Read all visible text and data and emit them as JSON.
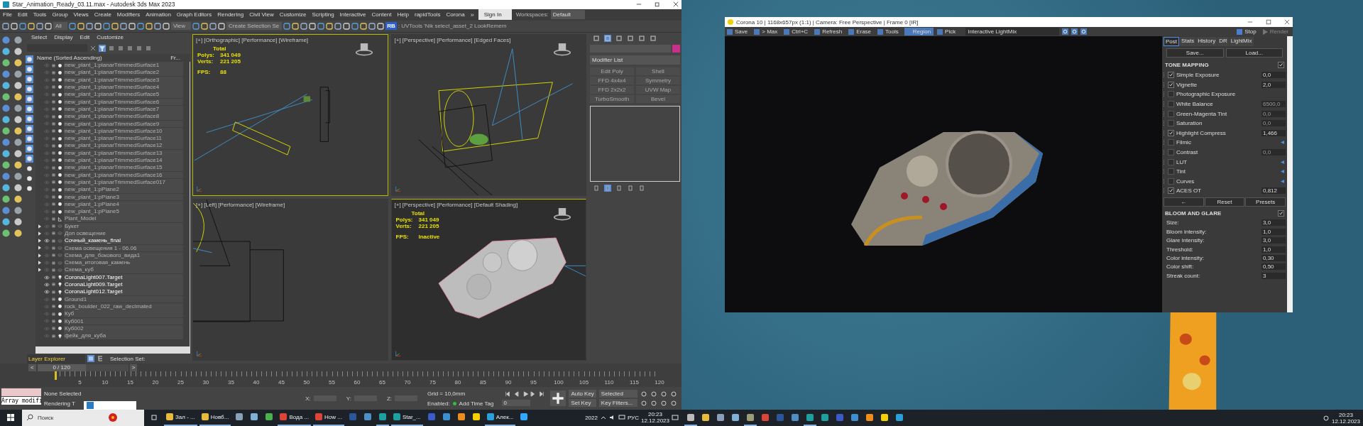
{
  "max": {
    "title": "Star_Animation_Ready_03.11.max - Autodesk 3ds Max 2023",
    "menu": [
      "File",
      "Edit",
      "Tools",
      "Group",
      "Views",
      "Create",
      "Modifiers",
      "Animation",
      "Graph Editors",
      "Rendering",
      "Civil View",
      "Customize",
      "Scripting",
      "Interactive",
      "Content",
      "Help",
      "rapidTools",
      "Corona"
    ],
    "more_menu": "»",
    "sign_in": "Sign In",
    "workspaces_label": "Workspaces:",
    "workspace": "Default",
    "toolbar": {
      "selection_filter": "All",
      "coord_system": "View",
      "selection_set": "Create Selection Se",
      "rb_badge": "RB",
      "script_text": ": UVTools 'Nik select_asset_2",
      "extra_text": "LookRemem"
    },
    "explorer": {
      "tabs": [
        "Select",
        "Display",
        "Edit",
        "Customize"
      ],
      "column_name": "Name (Sorted Ascending)",
      "column_2": "Fr...",
      "rows": [
        {
          "name": "new_plant_1:planarTrimmedSurface1",
          "kind": "object",
          "visible": false,
          "expandable": false
        },
        {
          "name": "new_plant_1:planarTrimmedSurface2",
          "kind": "object",
          "visible": false,
          "expandable": false
        },
        {
          "name": "new_plant_1:planarTrimmedSurface3",
          "kind": "object",
          "visible": false,
          "expandable": false
        },
        {
          "name": "new_plant_1:planarTrimmedSurface4",
          "kind": "object",
          "visible": false,
          "expandable": false
        },
        {
          "name": "new_plant_1:planarTrimmedSurface5",
          "kind": "object",
          "visible": false,
          "expandable": false
        },
        {
          "name": "new_plant_1:planarTrimmedSurface6",
          "kind": "object",
          "visible": false,
          "expandable": false
        },
        {
          "name": "new_plant_1:planarTrimmedSurface7",
          "kind": "object",
          "visible": false,
          "expandable": false
        },
        {
          "name": "new_plant_1:planarTrimmedSurface8",
          "kind": "object",
          "visible": false,
          "expandable": false
        },
        {
          "name": "new_plant_1:planarTrimmedSurface9",
          "kind": "object",
          "visible": false,
          "expandable": false
        },
        {
          "name": "new_plant_1:planarTrimmedSurface10",
          "kind": "object",
          "visible": false,
          "expandable": false
        },
        {
          "name": "new_plant_1:planarTrimmedSurface11",
          "kind": "object",
          "visible": false,
          "expandable": false
        },
        {
          "name": "new_plant_1:planarTrimmedSurface12",
          "kind": "object",
          "visible": false,
          "expandable": false
        },
        {
          "name": "new_plant_1:planarTrimmedSurface13",
          "kind": "object",
          "visible": false,
          "expandable": false
        },
        {
          "name": "new_plant_1:planarTrimmedSurface14",
          "kind": "object",
          "visible": false,
          "expandable": false
        },
        {
          "name": "new_plant_1:planarTrimmedSurface15",
          "kind": "object",
          "visible": false,
          "expandable": false
        },
        {
          "name": "new_plant_1:planarTrimmedSurface16",
          "kind": "object",
          "visible": false,
          "expandable": false
        },
        {
          "name": "new_plant_1:planarTrimmedSurface017",
          "kind": "object",
          "visible": false,
          "expandable": false
        },
        {
          "name": "new_plant_1:pPlane2",
          "kind": "object",
          "visible": false,
          "expandable": false
        },
        {
          "name": "new_plant_1:pPlane3",
          "kind": "object",
          "visible": false,
          "expandable": false
        },
        {
          "name": "new_plant_1:pPlane4",
          "kind": "object",
          "visible": false,
          "expandable": false
        },
        {
          "name": "new_plant_1:pPlane5",
          "kind": "object",
          "visible": false,
          "expandable": false
        },
        {
          "name": "Plant_Model",
          "kind": "bone",
          "visible": false,
          "expandable": false
        },
        {
          "name": "Букет",
          "kind": "layer",
          "visible": false,
          "expandable": true
        },
        {
          "name": "Доп освещение",
          "kind": "layer",
          "visible": false,
          "expandable": true
        },
        {
          "name": "Сочный_камень_final",
          "kind": "layer",
          "visible": true,
          "expandable": true
        },
        {
          "name": "Схема освещения 1 - 06.06",
          "kind": "layer",
          "visible": false,
          "expandable": true
        },
        {
          "name": "Схема_для_бокового_вида1",
          "kind": "layer",
          "visible": false,
          "expandable": true
        },
        {
          "name": "Схема_итоговая_камень",
          "kind": "layer",
          "visible": false,
          "expandable": true
        },
        {
          "name": "Схема_куб",
          "kind": "layer",
          "visible": false,
          "expandable": true
        },
        {
          "name": "CoronaLight007.Target",
          "kind": "light",
          "visible": true,
          "expandable": false
        },
        {
          "name": "CoronaLight009.Target",
          "kind": "light",
          "visible": true,
          "expandable": false
        },
        {
          "name": "CoronaLight012.Target",
          "kind": "light",
          "visible": true,
          "expandable": false
        },
        {
          "name": "Ground1",
          "kind": "object",
          "visible": false,
          "expandable": false
        },
        {
          "name": "rock_boulder_022_raw_decimated",
          "kind": "object",
          "visible": false,
          "expandable": false
        },
        {
          "name": "Куб",
          "kind": "object",
          "visible": false,
          "expandable": false
        },
        {
          "name": "Куб001",
          "kind": "object",
          "visible": false,
          "expandable": false
        },
        {
          "name": "Куб002",
          "kind": "object",
          "visible": false,
          "expandable": false
        },
        {
          "name": "фейк_для_куба",
          "kind": "light",
          "visible": false,
          "expandable": false
        }
      ],
      "footer": "Layer Explorer",
      "selection_set": "Selection Set:"
    },
    "viewports": [
      {
        "kind": "ortho",
        "label": "[+] [Orthographic] [Performance] [Wireframe]",
        "active": true,
        "stats": {
          "total": "Total",
          "polys_label": "Polys:",
          "polys": "341 049",
          "verts_label": "Verts:",
          "verts": "221 205",
          "fps_label": "FPS:",
          "fps": "88"
        }
      },
      {
        "kind": "perspective",
        "label": "[+] [Perspective] [Performance] [Edged Faces]",
        "active": false
      },
      {
        "kind": "left",
        "label": "[+] [Left] [Performance] [Wireframe]",
        "active": false
      },
      {
        "kind": "shaded",
        "label": "[+] [Perspective] [Performance] [Default Shading]",
        "active": false,
        "stats": {
          "total": "Total",
          "polys_label": "Polys:",
          "polys": "341 049",
          "verts_label": "Verts:",
          "verts": "221 205",
          "fps_label": "FPS:",
          "fps": "Inactive"
        }
      }
    ],
    "command_panel": {
      "modifier_list": "Modifier List",
      "modifiers": [
        "Edit Poly",
        "Shell",
        "FFD 4x4x4",
        "Symmetry",
        "FFD 2x2x2",
        "UVW Map",
        "TurboSmooth",
        "Bevel"
      ]
    },
    "timeline": {
      "prev": "<",
      "next": ">",
      "frame": "0 / 120",
      "level": 0,
      "ticks": [
        "5",
        "10",
        "15",
        "20",
        "25",
        "30",
        "35",
        "40",
        "45",
        "50",
        "55",
        "60",
        "65",
        "70",
        "75",
        "80",
        "85",
        "90",
        "95",
        "100",
        "105",
        "110",
        "115",
        "120"
      ]
    },
    "status": {
      "listener": "Array modifi",
      "message": "None Selected",
      "prompt": "Rendering T",
      "x_label": "X:",
      "y_label": "Y:",
      "z_label": "Z:",
      "grid": "Grid = 10,0mm",
      "enabled": "Enabled:",
      "add_time_tag": "Add Time Tag",
      "auto_key": "Auto Key",
      "key_mode": "Selected",
      "set_key": "Set Key",
      "key_filters": "Key Filters...",
      "current_frame": "0"
    }
  },
  "taskbar_left": {
    "search": {
      "placeholder": "Поиск"
    },
    "apps": [
      {
        "kind": "app",
        "label": "Зал - ...",
        "active": true
      },
      {
        "kind": "app",
        "label": "Новб...",
        "active": true
      },
      {
        "kind": "icon",
        "active": false
      },
      {
        "kind": "icon",
        "active": false
      },
      {
        "kind": "icon",
        "active": false
      },
      {
        "kind": "app",
        "label": "Вода ...",
        "active": true
      },
      {
        "kind": "app",
        "label": "How ...",
        "active": true
      },
      {
        "kind": "icon",
        "active": false
      },
      {
        "kind": "icon",
        "active": false
      },
      {
        "kind": "icon",
        "active": true
      },
      {
        "kind": "app",
        "label": "Star_...",
        "active": true
      },
      {
        "kind": "icon",
        "active": false
      },
      {
        "kind": "icon",
        "active": false
      },
      {
        "kind": "icon",
        "active": false
      },
      {
        "kind": "icon",
        "active": false
      },
      {
        "kind": "app",
        "label": "Алек...",
        "active": true
      },
      {
        "kind": "icon",
        "active": false
      }
    ],
    "tray_text": "2022",
    "language": "РУС",
    "time": "20:23",
    "date": "12.12.2023"
  },
  "taskbar_right": {
    "icons": [
      {
        "active": true
      },
      {
        "active": false
      },
      {
        "active": false
      },
      {
        "active": false
      },
      {
        "active": true
      },
      {
        "active": false
      },
      {
        "active": false
      },
      {
        "active": false
      },
      {
        "active": true
      },
      {
        "active": false
      },
      {
        "active": false
      },
      {
        "active": false
      },
      {
        "active": false
      },
      {
        "active": false
      },
      {
        "active": false
      }
    ],
    "time": "20:23",
    "date": "12.12.2023"
  },
  "corona": {
    "title": "Corona 10 | 1168x657px (1:1) | Camera: Free Perspective | Frame 0 [IR]",
    "toolbar": [
      {
        "label": "Save",
        "selected": false
      },
      {
        "label": "> Max",
        "selected": false
      },
      {
        "label": "Ctrl+C",
        "selected": false
      },
      {
        "label": "Refresh",
        "selected": false
      },
      {
        "label": "Erase",
        "selected": false
      },
      {
        "label": "Tools",
        "selected": false
      },
      {
        "label": "Region",
        "selected": true
      },
      {
        "label": "Pick",
        "selected": false
      }
    ],
    "lightmix": "Interactive LightMix",
    "stop": "Stop",
    "render": "Render",
    "render_disabled": true,
    "tabs": [
      {
        "label": "Post",
        "selected": true
      },
      {
        "label": "Stats",
        "selected": false
      },
      {
        "label": "History",
        "selected": false
      },
      {
        "label": "DR",
        "selected": false
      },
      {
        "label": "LightMix",
        "selected": false
      }
    ],
    "save": "Save...",
    "load": "Load...",
    "tone_mapping": {
      "title": "TONE MAPPING",
      "enabled": true,
      "rows": [
        {
          "kind": "value",
          "label": "Simple Exposure",
          "checked": true,
          "value": "0,0"
        },
        {
          "kind": "value",
          "label": "Vignette",
          "checked": true,
          "value": "2,0"
        },
        {
          "kind": "plain",
          "label": "Photographic Exposure",
          "checked": false
        },
        {
          "kind": "value",
          "label": "White Balance",
          "checked": false,
          "value": "6500,0"
        },
        {
          "kind": "value",
          "label": "Green-Magenta Tint",
          "checked": false,
          "value": "0,0"
        },
        {
          "kind": "value",
          "label": "Saturation",
          "checked": false,
          "value": "0,0"
        },
        {
          "kind": "value",
          "label": "Highlight Compress",
          "checked": true,
          "value": "1,466"
        },
        {
          "kind": "submenu",
          "label": "Filmic",
          "checked": false
        },
        {
          "kind": "value",
          "label": "Contrast",
          "checked": false,
          "value": "0,0"
        },
        {
          "kind": "submenu",
          "label": "LUT",
          "checked": false
        },
        {
          "kind": "submenu",
          "label": "Tint",
          "checked": false
        },
        {
          "kind": "submenu",
          "label": "Curves",
          "checked": false
        },
        {
          "kind": "value",
          "label": "ACES OT",
          "checked": true,
          "value": "0,812"
        }
      ]
    },
    "nav": [
      "←",
      "Reset",
      "Presets"
    ],
    "bloom": {
      "title": "BLOOM AND GLARE",
      "enabled": true,
      "rows": [
        {
          "label": "Size:",
          "value": "3,0"
        },
        {
          "label": "Bloom intensity:",
          "value": "1,0"
        },
        {
          "label": "Glare intensity:",
          "value": "3,0"
        },
        {
          "label": "Threshold:",
          "value": "1,0"
        },
        {
          "label": "Color intensity:",
          "value": "0,30"
        },
        {
          "label": "Color shift:",
          "value": "0,50"
        },
        {
          "label": "Streak count:",
          "value": "3"
        }
      ]
    }
  }
}
